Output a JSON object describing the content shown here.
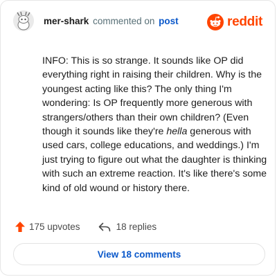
{
  "comment": {
    "username": "mer-shark",
    "action_text": "commented on",
    "target_link": "post",
    "brand_name": "reddit",
    "body_prefix": "INFO: This is so strange. It sounds like OP did everything right in raising their children. Why is the youngest acting like this? The only thing I'm wondering: Is OP frequently more generous with strangers/others than their own children? (Even though it sounds like they're ",
    "body_emphasis": "hella",
    "body_suffix": " generous with used cars, college educations, and weddings.) I'm just trying to figure out what the daughter is thinking with such an extreme reaction. It's like there's some kind of old wound or history there.",
    "upvotes_label": "175 upvotes",
    "replies_label": "18 replies",
    "view_button_label": "View 18 comments"
  },
  "icons": {
    "avatar": "snoo-avatar-icon",
    "brand": "reddit-logo-icon",
    "upvote": "upvote-arrow-icon",
    "reply": "reply-arrow-icon"
  },
  "colors": {
    "brand_orange": "#ff4500",
    "link_blue": "#0a58ca",
    "muted_text": "#576f76",
    "upvote_orange": "#ff4500"
  }
}
